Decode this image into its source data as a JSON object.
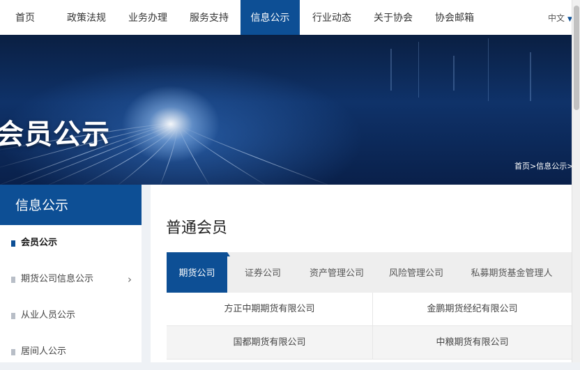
{
  "nav": {
    "items": [
      {
        "label": "首页"
      },
      {
        "label": "政策法规"
      },
      {
        "label": "业务办理"
      },
      {
        "label": "服务支持"
      },
      {
        "label": "信息公示",
        "active": true
      },
      {
        "label": "行业动态"
      },
      {
        "label": "关于协会"
      },
      {
        "label": "协会邮箱"
      }
    ],
    "language": "中文",
    "language_icon": "caret-down-icon"
  },
  "banner": {
    "title": "会员公示",
    "breadcrumb": "首页>信息公示>会员"
  },
  "sidebar": {
    "heading": "信息公示",
    "items": [
      {
        "label": "会员公示",
        "active": true
      },
      {
        "label": "期货公司信息公示",
        "has_submenu": true
      },
      {
        "label": "从业人员公示"
      },
      {
        "label": "居间人公示"
      }
    ]
  },
  "main": {
    "title": "普通会员",
    "tabs": [
      {
        "label": "期货公司",
        "active": true
      },
      {
        "label": "证券公司"
      },
      {
        "label": "资产管理公司"
      },
      {
        "label": "风险管理公司"
      },
      {
        "label": "私募期货基金管理人"
      }
    ],
    "rows": [
      [
        "方正中期期货有限公司",
        "金鹏期货经纪有限公司"
      ],
      [
        "国都期货有限公司",
        "中粮期货有限公司"
      ]
    ]
  },
  "colors": {
    "brand": "#0d4f95",
    "tab_bar": "#eeeeee",
    "page_bg": "#eef1f5"
  }
}
